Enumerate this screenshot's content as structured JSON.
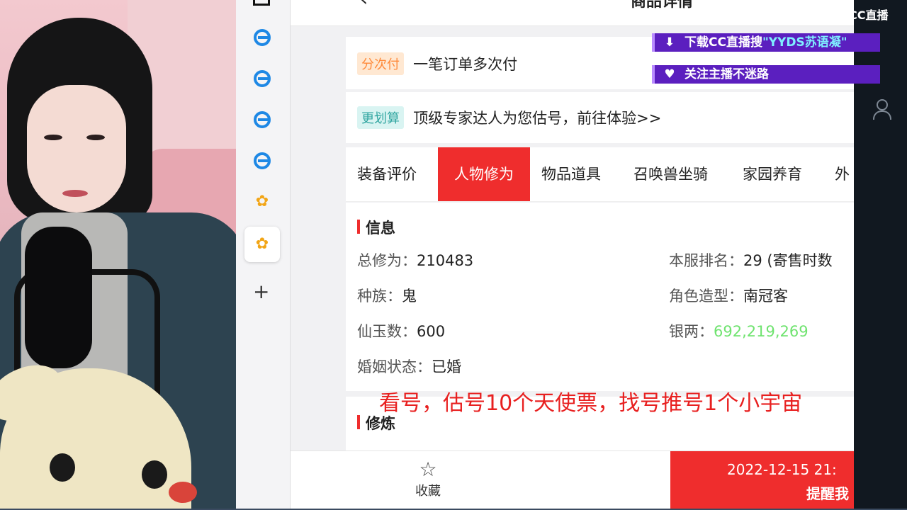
{
  "page": {
    "title": "商品详情",
    "back_icon": "chevron-left-icon"
  },
  "promos": [
    {
      "tag": "分次付",
      "text": "一笔订单多次付",
      "tag_bg": "#ffe8d2",
      "tag_color": "#ff8a3a"
    },
    {
      "tag": "更划算",
      "text": "顶级专家达人为您估号，前往体验>>",
      "tag_bg": "#d9f4f2",
      "tag_color": "#31a6a1"
    }
  ],
  "tabs": [
    "装备评价",
    "人物修为",
    "物品道具",
    "召唤兽坐骑",
    "家园养育",
    "外"
  ],
  "active_tab": "人物修为",
  "info": {
    "title": "信息",
    "fields": [
      {
        "label": "总修为：",
        "value": "210483"
      },
      {
        "label": "本服排名：",
        "value": "29 (寄售时数"
      },
      {
        "label": "种族：",
        "value": "鬼"
      },
      {
        "label": "角色造型：",
        "value": "南冠客"
      },
      {
        "label": "仙玉数：",
        "value": "600"
      },
      {
        "label": "银两：",
        "value": "692,219,269",
        "color": "#6fe36f"
      },
      {
        "label": "婚姻状态：",
        "value": "已婚"
      }
    ]
  },
  "cultivation": {
    "title": "修炼"
  },
  "footer": {
    "favorite_label": "收藏",
    "favorite_icon": "star-icon",
    "date": "2022-12-15 21:",
    "remind_label": "提醒我"
  },
  "subtitle": "看号，估号10个天使票，找号推号1个小宇宙",
  "overlay": {
    "banner1_prefix": "下载CC直播搜",
    "banner1_highlight": "\"YYDS苏语凝\"",
    "banner1_icon": "download-icon",
    "banner2_text": "关注主播不迷路",
    "banner2_icon": "heart-icon",
    "logo": "CC直播"
  },
  "colors": {
    "accent": "#ef2d2d",
    "banner": "#5b1fbf"
  }
}
